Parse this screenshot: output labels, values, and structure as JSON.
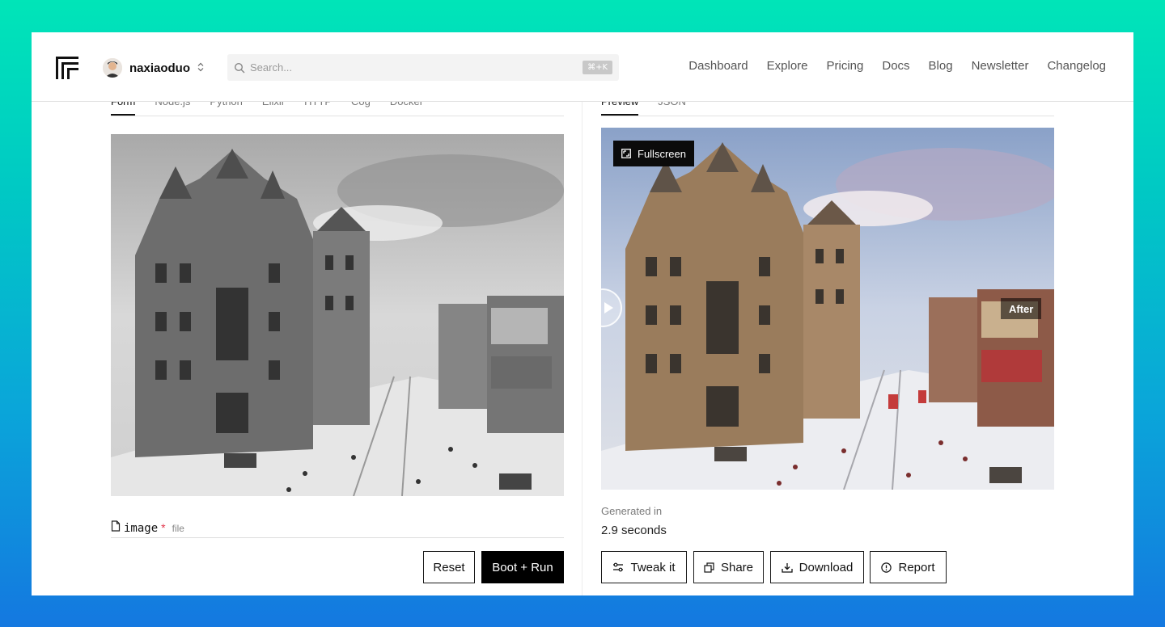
{
  "header": {
    "username": "naxiaoduo",
    "search": {
      "placeholder": "Search...",
      "shortcut": "⌘+K"
    },
    "nav": [
      "Dashboard",
      "Explore",
      "Pricing",
      "Docs",
      "Blog",
      "Newsletter",
      "Changelog"
    ]
  },
  "left_panel": {
    "tabs": [
      "Form",
      "Node.js",
      "Python",
      "Elixir",
      "HTTP",
      "Cog",
      "Docker"
    ],
    "active_tab": "Form",
    "input_field": {
      "name": "image",
      "required_mark": "*",
      "type": "file"
    },
    "buttons": {
      "reset": "Reset",
      "boot_run": "Boot + Run"
    }
  },
  "right_panel": {
    "tabs": [
      "Preview",
      "JSON"
    ],
    "active_tab": "Preview",
    "fullscreen_label": "Fullscreen",
    "after_label": "After",
    "generated_label": "Generated in",
    "generated_value": "2.9 seconds",
    "actions": {
      "tweak": "Tweak it",
      "share": "Share",
      "download": "Download",
      "report": "Report"
    }
  },
  "colors": {
    "accent": "#000000",
    "required": "#e2354a",
    "background_gradient_top": "#00e5b8",
    "background_gradient_bottom": "#1478e0"
  }
}
